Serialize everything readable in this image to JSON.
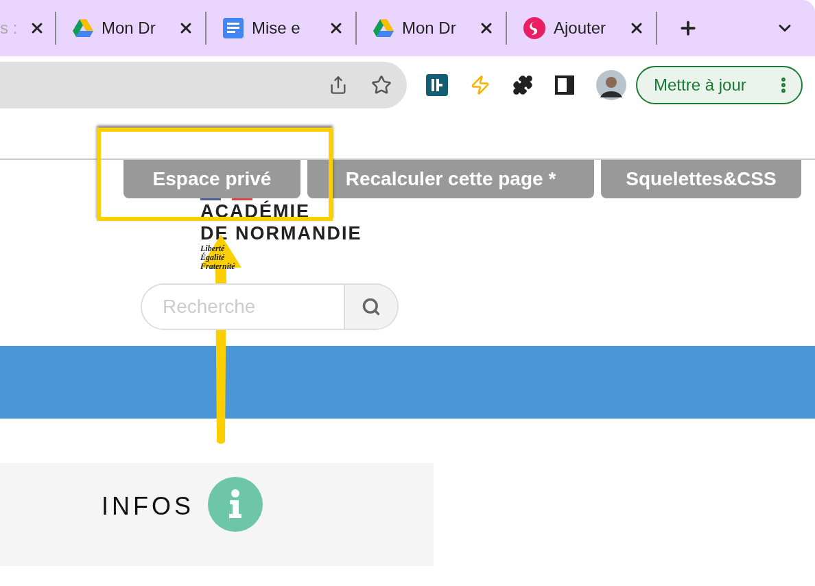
{
  "browser": {
    "tabs": [
      {
        "title": "s :",
        "kind": "plain",
        "selected": false
      },
      {
        "title": "Mon Dr",
        "kind": "drive",
        "selected": false
      },
      {
        "title": "Mise e",
        "kind": "docs",
        "selected": false
      },
      {
        "title": "Mon Dr",
        "kind": "drive",
        "selected": false
      },
      {
        "title": "Ajouter",
        "kind": "swirl",
        "selected": false
      }
    ],
    "update_button": "Mettre à jour"
  },
  "page": {
    "admin_buttons": [
      "Espace privé",
      "Recalculer cette page *",
      "Squelettes&CSS"
    ],
    "logo": {
      "lines": [
        "ACADÉMIE",
        "DE NORMANDIE"
      ],
      "motto": [
        "Liberté",
        "Égalité",
        "Fraternité"
      ]
    },
    "search": {
      "placeholder": "Recherche"
    },
    "infos": {
      "title": "INFOS"
    }
  }
}
